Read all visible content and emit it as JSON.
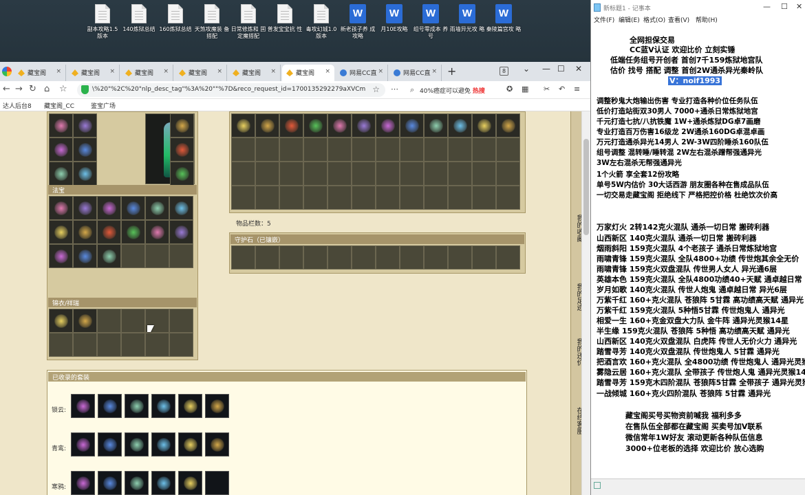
{
  "desktop": {
    "icons": [
      {
        "label": "副本攻略1.5\n版本",
        "type": "file"
      },
      {
        "label": "140炼狱总结",
        "type": "file"
      },
      {
        "label": "160炼狱总结",
        "type": "file"
      },
      {
        "label": "天煞攻魔装\n备搭配",
        "type": "file"
      },
      {
        "label": "日常修炼和\n固定魔搭配",
        "type": "file"
      },
      {
        "label": "普发宝宝抗\n性",
        "type": "file"
      },
      {
        "label": "毒攻幻城1.0\n版本",
        "type": "file"
      },
      {
        "label": "新老孩子养\n成攻略",
        "type": "word"
      },
      {
        "label": "月10E攻略",
        "type": "word"
      },
      {
        "label": "组号零成本\n养号",
        "type": "word"
      },
      {
        "label": "雨墙异光攻\n略",
        "type": "word"
      },
      {
        "label": "秦陵篇宫攻\n略",
        "type": "word"
      }
    ]
  },
  "browser": {
    "tabs": [
      {
        "label": "藏宝阁"
      },
      {
        "label": "藏宝阁"
      },
      {
        "label": "藏宝阁"
      },
      {
        "label": "藏宝阁"
      },
      {
        "label": "藏宝阁"
      },
      {
        "label": "藏宝阁"
      },
      {
        "label": "网易CC直"
      },
      {
        "label": "网易CC直"
      }
    ],
    "tab_count": "8",
    "url": "\\%20\"%2C%20\"nlp_desc_tag\"%3A%20\"\"%7D&reco_request_id=1700135292279aXVCm",
    "search_text": "40%癌症可以避免",
    "search_hot": "热搜",
    "bookmarks": [
      "达人后台8",
      "藏宝阁_CC",
      "鉴宝广场"
    ]
  },
  "game": {
    "section_fabao": "法宝",
    "section_pets": "锦衣/祥瑞",
    "item_count": "物品栏数：5",
    "gem_section": "守护石（已镶嵌）",
    "suit_section": "已收录的套装",
    "suit_rows": [
      {
        "label": "锁云:"
      },
      {
        "label": "青鸾:"
      },
      {
        "label": "寒鸦:"
      }
    ],
    "side_texts": [
      "我的收藏",
      "我的足迹",
      "我的还价",
      "在线客服"
    ]
  },
  "notepad": {
    "title": "新标题1 - 记事本",
    "menu": [
      "文件(F)",
      "编辑(E)",
      "格式(O)",
      "查看(V)",
      "帮助(H)"
    ],
    "lines": [
      "全网担保交易",
      "CC蓝V认证  欢迎比价  立刻实锤",
      "低端任务组号开创者          首创7千159炼狱地宫队",
      "估价 找号 搭配 调整          首创2W通杀异光秦岭队",
      "V：noif1993",
      "调整秒鬼大炮输出伤害          专业打造各种价位任务队伍",
      "低价打造站街双30男人          7000+通杀日常炼狱地宫",
      "千元打造七抗/八抗铁魔        1W+通杀炼狱DG卓7画磨",
      "专业打造百万伤害16级龙        2W通杀160DG卓混卓画",
      "万元打造通杀异光14男人       2W-3W四阶睡杀160队伍",
      "组号调整 混转睡/睡转混       2W左右混杀蹭帮强通异光",
      "                              3W左右混杀无帮强通异光",
      "1个火箭 享全套12份攻略",
      "单号5W内估价 30大话西游       朋友圈各种在售成品队伍",
      "一切交易走藏宝阁 拒绝线下    严格把控价格 杜绝饮次价高",
      "万家灯火 2转142克火混队 通杀一切日常 搬砖利器",
      "山西新区 140克火混队 通杀一切日常 搬砖利器",
      "烟雨斜阳 159克火混队 4个老孩子 通杀日常炼狱地宫",
      "雨啸青锋 159克火混队 全队4800+功绩 传世炮其余全无价",
      "雨啸青锋 159克火双盘混队 传世男人女人 异光通6层",
      "英雄本色 159克火混队 全队4800功绩40+天赋 通卓越日常",
      "岁月如歌 140克火混队 传世人炮鬼 通卓越日常 异光6层",
      "万紫千红 160+克火混队 苍狼阵 5甘霖 高功绩高天赋 通异光",
      "万紫千红 159克火混队 5种悟5甘霖 传世炮鬼人 通异光",
      "相爱一生 160+克金双盘大力队 金牛阵 通异光灵猴14星",
      "半生缘   159克火混队 苍狼阵 5种悟 高功绩高天赋 通异光",
      "山西新区 140克火双盘混队 白虎阵 传世人无价火力 通异光",
      "踏雪寻芳 140克火双盘混队 传世炮鬼人 5甘霖 通异光",
      "把酒言欢 160+克火混队 全4800功绩 传世炮鬼人 通异光灵猴",
      "雾隐云居 160+克火混队 全带孩子 传世炮人鬼 通异光灵猴14",
      "踏雪寻芳 159克木四阶混队 苍狼阵5甘霖 全带孩子 通异光灵猴",
      "一战倾城 160+克火四阶混队 苍狼阵 5甘霖 通异光",
      "藏宝阁买号买物资前喊我 福利多多",
      "在售队伍全部都在藏宝阁 买卖号加V联系",
      "微信常年1W好友 滚动更新各种队伍信息",
      "3000+位老板的选择 欢迎比价 放心选购"
    ]
  },
  "colors": {
    "selection": "#3874d8",
    "game_bg": "#efe6c9",
    "panel": "#d6caa0",
    "hot": "#e33333"
  }
}
